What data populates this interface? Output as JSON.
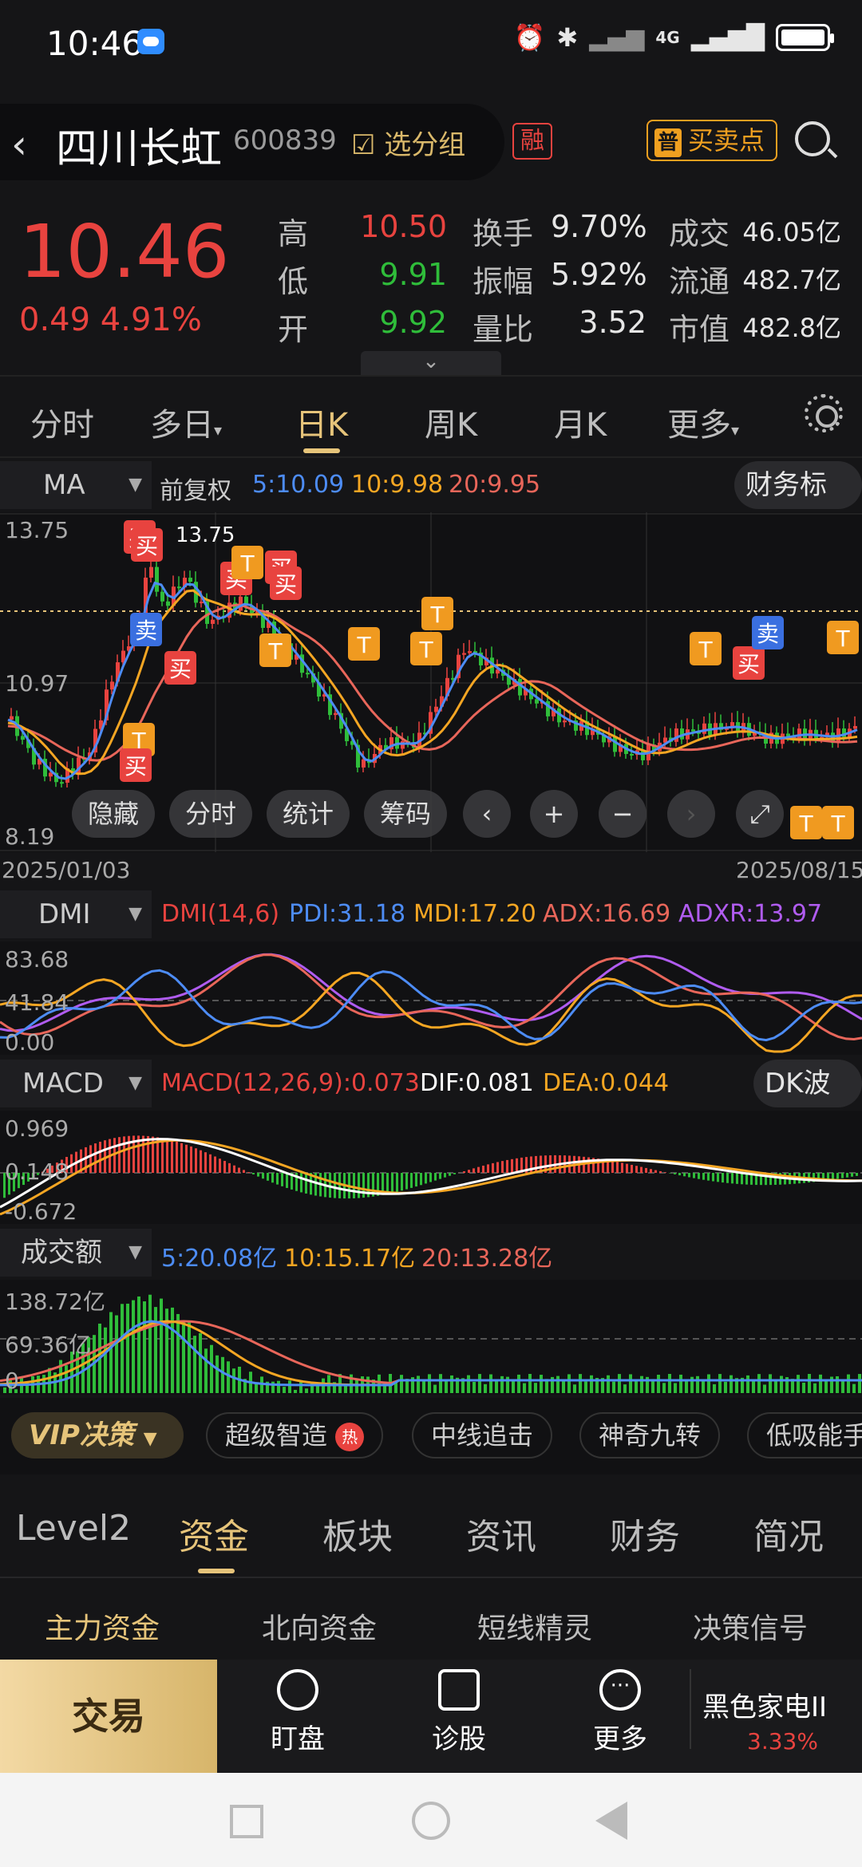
{
  "status": {
    "time": "10:46",
    "network": "4G"
  },
  "header": {
    "title": "四川长虹",
    "code": "600839",
    "add_group": "选分组",
    "margin_tag": "融",
    "bs_badge": "普",
    "bs_label": "买卖点"
  },
  "quote": {
    "price": "10.46",
    "change": "0.49",
    "change_pct": "4.91%",
    "high_label": "高",
    "high": "10.50",
    "low_label": "低",
    "low": "9.91",
    "open_label": "开",
    "open": "9.92",
    "turnover_label": "换手",
    "turnover": "9.70%",
    "amplitude_label": "振幅",
    "amplitude": "5.92%",
    "vol_ratio_label": "量比",
    "vol_ratio": "3.52",
    "amount_label": "成交",
    "amount": "46.05亿",
    "float_label": "流通",
    "float_cap": "482.7亿",
    "mcap_label": "市值",
    "mcap": "482.8亿"
  },
  "period_tabs": [
    "分时",
    "多日",
    "日K",
    "周K",
    "月K",
    "更多"
  ],
  "active_period": "日K",
  "ma_panel": {
    "selector": "MA",
    "adjust": "前复权",
    "ma5": "5:10.09",
    "ma10": "10:9.98",
    "ma20": "20:9.95",
    "finance_btn": "财务标记",
    "y_top": "13.75",
    "y_mid": "10.97",
    "y_bot": "8.19",
    "peak_label": "13.75",
    "low_label": "8.19",
    "date_start": "2025/01/03",
    "date_end": "2025/08/15",
    "controls": [
      "隐藏",
      "分时",
      "统计",
      "筹码"
    ],
    "sell": "卖",
    "buy": "买",
    "t": "T"
  },
  "dmi_panel": {
    "selector": "DMI",
    "params": "DMI(14,6)",
    "pdi": "PDI:31.18",
    "mdi": "MDI:17.20",
    "adx": "ADX:16.69",
    "adxr": "ADXR:13.97",
    "y_top": "83.68",
    "y_mid": "41.84",
    "y_bot": "0.00"
  },
  "macd_panel": {
    "selector": "MACD",
    "params": "MACD(12,26,9):0.073",
    "dif": "DIF:0.081",
    "dea": "DEA:0.044",
    "dk_btn": "DK波段",
    "y_top": "0.969",
    "y_mid": "0.148",
    "y_bot": "-0.672"
  },
  "vol_panel": {
    "selector": "成交额",
    "ma5": "5:20.08亿",
    "ma10": "10:15.17亿",
    "ma20": "20:13.28亿",
    "y_top": "138.72亿",
    "y_mid": "69.36亿",
    "y_bot": "0"
  },
  "strategy": {
    "vip": "VIP决策",
    "chips": [
      "超级智造",
      "中线追击",
      "神奇九转",
      "低吸能手"
    ],
    "hot": "热"
  },
  "info_tabs": [
    "Level2",
    "资金",
    "板块",
    "资讯",
    "财务",
    "简况"
  ],
  "active_info_tab": "资金",
  "fund_tabs": [
    "主力资金",
    "北向资金",
    "短线精灵",
    "决策信号"
  ],
  "bottom": {
    "trade": "交易",
    "watch": "盯盘",
    "diagnose": "诊股",
    "more": "更多",
    "sector": "黑色家电II",
    "sector_pct": "3.33%"
  },
  "colors": {
    "up": "#e8433f",
    "down": "#2fbd3a",
    "accent": "#e6c47a",
    "ma5": "#4d8cf5",
    "ma10": "#f5a623",
    "ma20": "#e8665a",
    "adxr": "#b05cf0"
  }
}
